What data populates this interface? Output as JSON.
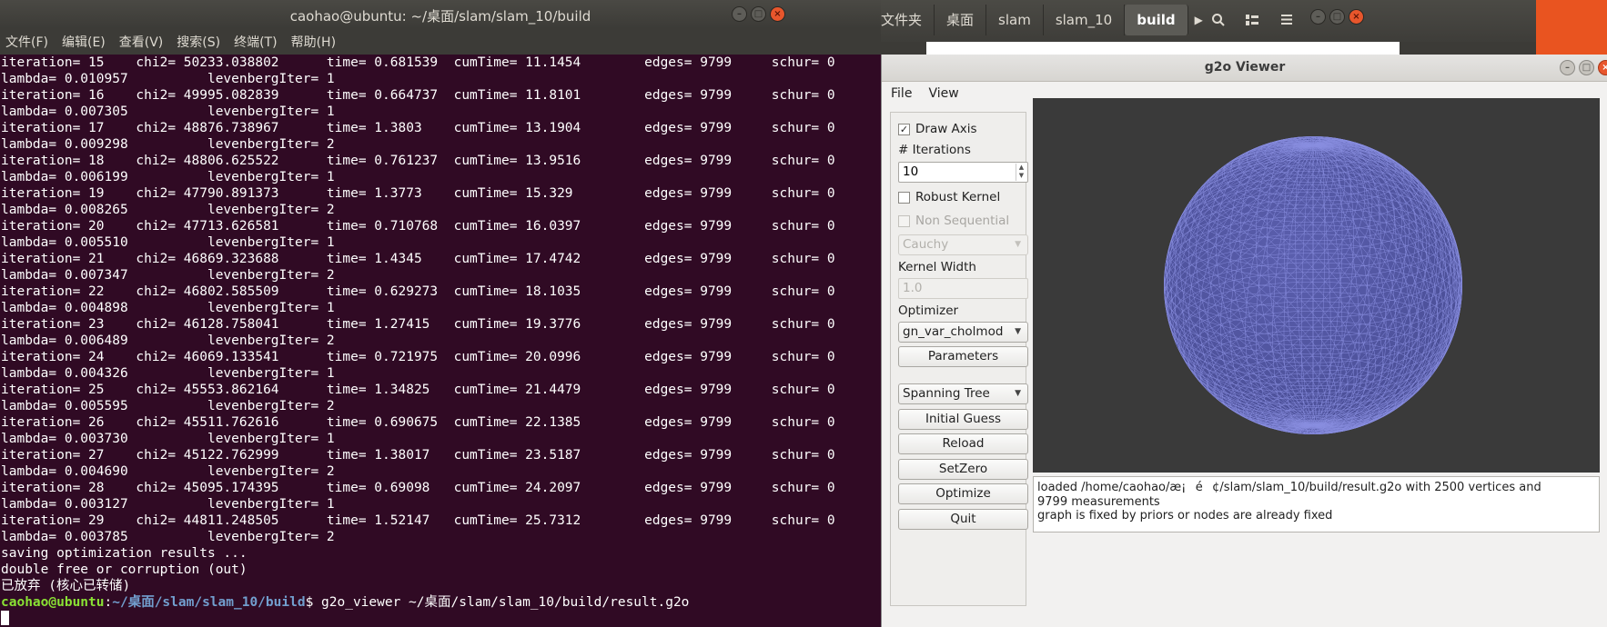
{
  "terminal": {
    "title": "caohao@ubuntu: ~/桌面/slam/slam_10/build",
    "menu": [
      "文件(F)",
      "编辑(E)",
      "查看(V)",
      "搜索(S)",
      "终端(T)",
      "帮助(H)"
    ],
    "lines": [
      "iteration= 15    chi2= 50233.038802      time= 0.681539  cumTime= 11.1454        edges= 9799     schur= 0",
      "lambda= 0.010957          levenbergIter= 1",
      "iteration= 16    chi2= 49995.082839      time= 0.664737  cumTime= 11.8101        edges= 9799     schur= 0",
      "lambda= 0.007305          levenbergIter= 1",
      "iteration= 17    chi2= 48876.738967      time= 1.3803    cumTime= 13.1904        edges= 9799     schur= 0",
      "lambda= 0.009298          levenbergIter= 2",
      "iteration= 18    chi2= 48806.625522      time= 0.761237  cumTime= 13.9516        edges= 9799     schur= 0",
      "lambda= 0.006199          levenbergIter= 1",
      "iteration= 19    chi2= 47790.891373      time= 1.3773    cumTime= 15.329         edges= 9799     schur= 0",
      "lambda= 0.008265          levenbergIter= 2",
      "iteration= 20    chi2= 47713.626581      time= 0.710768  cumTime= 16.0397        edges= 9799     schur= 0",
      "lambda= 0.005510          levenbergIter= 1",
      "iteration= 21    chi2= 46869.323688      time= 1.4345    cumTime= 17.4742        edges= 9799     schur= 0",
      "lambda= 0.007347          levenbergIter= 2",
      "iteration= 22    chi2= 46802.585509      time= 0.629273  cumTime= 18.1035        edges= 9799     schur= 0",
      "lambda= 0.004898          levenbergIter= 1",
      "iteration= 23    chi2= 46128.758041      time= 1.27415   cumTime= 19.3776        edges= 9799     schur= 0",
      "lambda= 0.006489          levenbergIter= 2",
      "iteration= 24    chi2= 46069.133541      time= 0.721975  cumTime= 20.0996        edges= 9799     schur= 0",
      "lambda= 0.004326          levenbergIter= 1",
      "iteration= 25    chi2= 45553.862164      time= 1.34825   cumTime= 21.4479        edges= 9799     schur= 0",
      "lambda= 0.005595          levenbergIter= 2",
      "iteration= 26    chi2= 45511.762616      time= 0.690675  cumTime= 22.1385        edges= 9799     schur= 0",
      "lambda= 0.003730          levenbergIter= 1",
      "iteration= 27    chi2= 45122.762999      time= 1.38017   cumTime= 23.5187        edges= 9799     schur= 0",
      "lambda= 0.004690          levenbergIter= 2",
      "iteration= 28    chi2= 45095.174395      time= 0.69098   cumTime= 24.2097        edges= 9799     schur= 0",
      "lambda= 0.003127          levenbergIter= 1",
      "iteration= 29    chi2= 44811.248505      time= 1.52147   cumTime= 25.7312        edges= 9799     schur= 0",
      "lambda= 0.003785          levenbergIter= 2",
      "saving optimization results ...",
      "double free or corruption (out)",
      "已放弃 (核心已转储)"
    ],
    "prompt": {
      "user_host": "caohao@ubuntu",
      "separator": ":",
      "path": "~/桌面/slam/slam_10/build",
      "command": "$ g2o_viewer ~/桌面/slam/slam_10/build/result.g2o"
    }
  },
  "files": {
    "breadcrumbs": [
      "文件夹",
      "桌面",
      "slam",
      "slam_10",
      "build"
    ],
    "active_crumb": "build",
    "toolbar_icons": [
      "search-icon",
      "view-toggle-icon",
      "hamburger-menu-icon"
    ]
  },
  "viewer": {
    "title": "g2o Viewer",
    "menu": [
      "File",
      "View"
    ],
    "draw_axis": {
      "label": "Draw Axis",
      "checked": true
    },
    "iterations": {
      "label": "# Iterations",
      "value": "10"
    },
    "robust_kernel": {
      "label": "Robust Kernel",
      "checked": false
    },
    "non_sequential": {
      "label": "Non Sequential",
      "checked": false
    },
    "kernel_type": "Cauchy",
    "kernel_width": {
      "label": "Kernel Width",
      "value": "1.0"
    },
    "optimizer": {
      "label": "Optimizer",
      "value": "gn_var_cholmod"
    },
    "parameters_button": "Parameters",
    "initial_method": "Spanning Tree",
    "buttons": {
      "initial_guess": "Initial Guess",
      "reload": "Reload",
      "set_zero": "SetZero",
      "optimize": "Optimize",
      "quit": "Quit"
    },
    "log": [
      "loaded /home/caohao/æ¡é¢/slam/slam_10/build/result.g2o with 2500 vertices and",
      "9799 measurements",
      "graph is fixed by priors or nodes are already fixed"
    ],
    "colors": {
      "viewport_bg": "#3a3a3a",
      "mesh": "#6a6fc0"
    }
  }
}
